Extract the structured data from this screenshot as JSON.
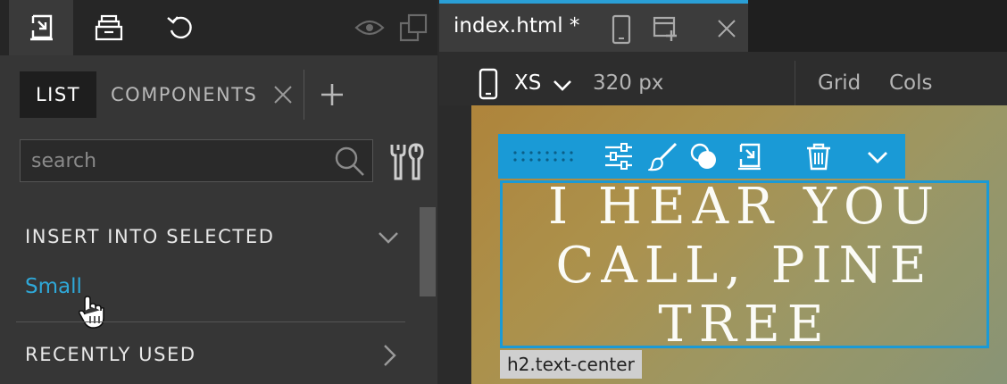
{
  "left_panel": {
    "toolbar": {
      "insert_icon": "insert-into-icon",
      "library_icon": "library-tray-icon",
      "undo_icon": "undo-icon",
      "visibility_icon": "eye-icon",
      "duplicate_icon": "duplicate-icon"
    },
    "tabs": {
      "list": "LIST",
      "components": "COMPONENTS"
    },
    "search": {
      "placeholder": "search",
      "value": ""
    },
    "sections": {
      "insert_into_selected": "INSERT INTO SELECTED",
      "item_small": "Small",
      "recently_used": "RECENTLY USED"
    }
  },
  "editor": {
    "doc_tab": {
      "title": "index.html *"
    },
    "device_bar": {
      "size": "XS",
      "width": "320 px",
      "grid": "Grid",
      "cols": "Cols"
    },
    "canvas": {
      "heading": "I HEAR YOU CALL, PINE TREE",
      "element_label": "h2.text-center"
    }
  },
  "colors": {
    "accent_blue": "#1a9ad6",
    "link_blue": "#2fa8d8",
    "panel_bg": "#363636",
    "toolbar_bg": "#262626"
  }
}
